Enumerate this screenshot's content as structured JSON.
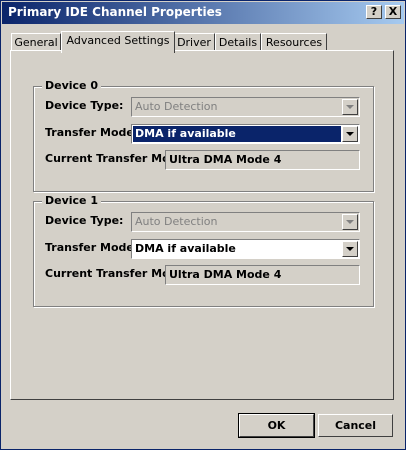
{
  "window": {
    "title": "Primary IDE Channel Properties",
    "help_label": "?",
    "close_label": "X"
  },
  "tabs": [
    {
      "label": "General"
    },
    {
      "label": "Advanced Settings"
    },
    {
      "label": "Driver"
    },
    {
      "label": "Details"
    },
    {
      "label": "Resources"
    }
  ],
  "device0": {
    "legend": "Device 0",
    "device_type_label": "Device Type:",
    "device_type_value": "Auto Detection",
    "transfer_mode_label": "Transfer Mode:",
    "transfer_mode_value": "DMA if available",
    "current_label": "Current Transfer Mode:",
    "current_value": "Ultra DMA Mode 4"
  },
  "device1": {
    "legend": "Device 1",
    "device_type_label": "Device Type:",
    "device_type_value": "Auto Detection",
    "transfer_mode_label": "Transfer Mode:",
    "transfer_mode_value": "DMA if available",
    "current_label": "Current Transfer Mode:",
    "current_value": "Ultra DMA Mode 4"
  },
  "buttons": {
    "ok": "OK",
    "cancel": "Cancel"
  }
}
